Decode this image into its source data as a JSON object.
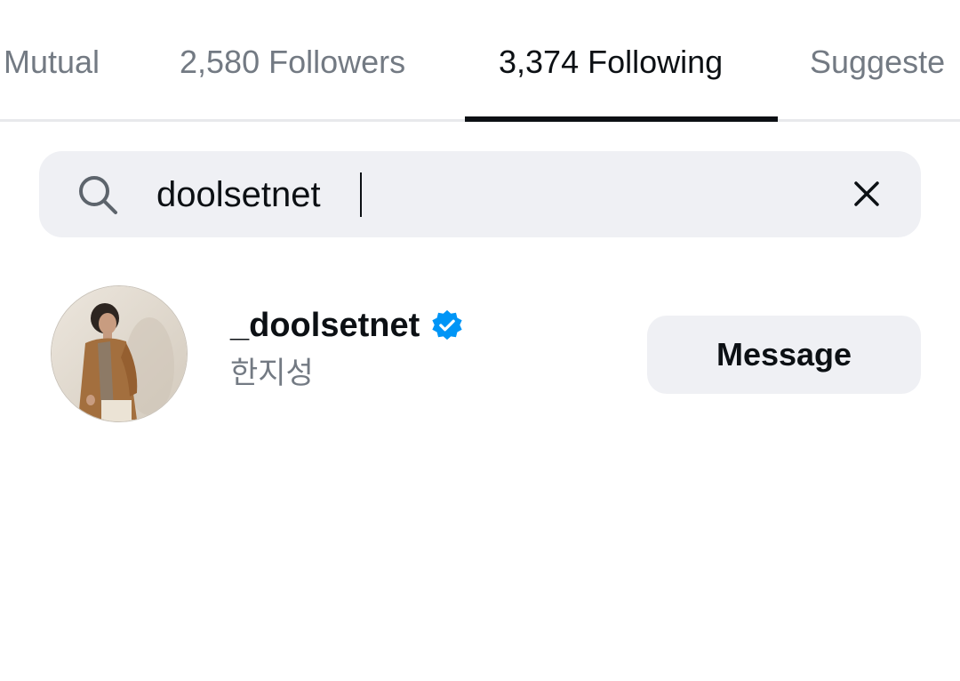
{
  "tabs": [
    {
      "label": "Mutual",
      "active": false
    },
    {
      "label": "2,580 Followers",
      "active": false
    },
    {
      "label": "3,374 Following",
      "active": true
    },
    {
      "label": "Suggeste",
      "active": false
    }
  ],
  "search": {
    "value": "doolsetnet",
    "icon": "search-icon",
    "clear_icon": "close-icon"
  },
  "result": {
    "username": "_doolsetnet",
    "verified": true,
    "full_name": "한지성",
    "message_label": "Message",
    "avatar": "profile-photo"
  },
  "colors": {
    "text_primary": "#0c1014",
    "text_secondary": "#737a83",
    "surface": "#eff0f4",
    "verified_blue": "#0095f6",
    "divider": "#e8e9ec"
  }
}
